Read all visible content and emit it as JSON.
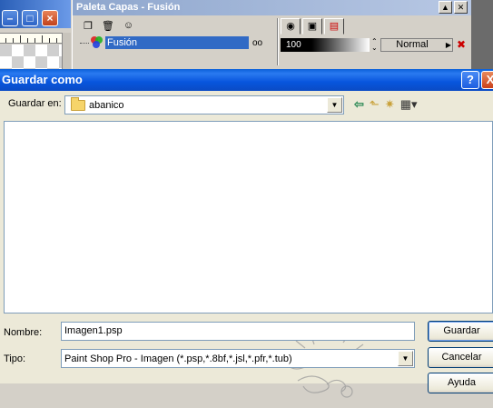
{
  "background": {
    "layers_palette": {
      "title": "Paleta Capas - Fusión",
      "layer_name": "Fusión",
      "opacity": "100",
      "blend_mode": "Normal"
    }
  },
  "dialog": {
    "title": "Guardar como",
    "help_glyph": "?",
    "close_glyph": "X",
    "save_in_label": "Guardar en:",
    "save_in_value": "abanico",
    "name_label": "Nombre:",
    "name_value": "Imagen1.psp",
    "type_label": "Tipo:",
    "type_value": "Paint Shop Pro - Imagen (*.psp,*.8bf,*.jsl,*.pfr,*.tub)",
    "buttons": {
      "save": "Guardar",
      "cancel": "Cancelar",
      "help": "Ayuda"
    }
  },
  "colors": {
    "title_bar": "#0a5fd8",
    "dialog_face": "#ece9d8",
    "selection": "#316ac5"
  },
  "icons": [
    "back-icon",
    "up-folder-icon",
    "new-folder-icon",
    "views-menu-icon",
    "folder-icon"
  ]
}
